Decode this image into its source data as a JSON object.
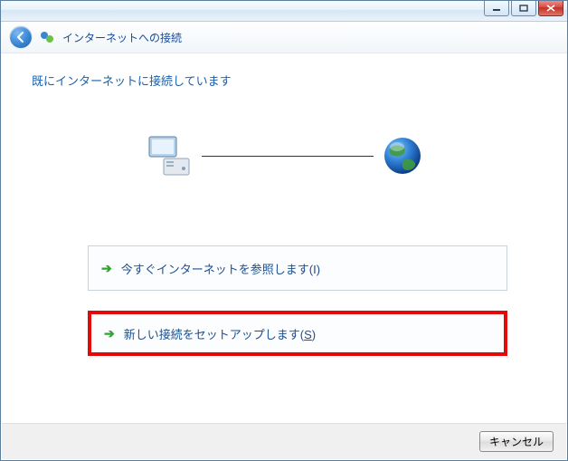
{
  "header": {
    "title": "インターネットへの接続"
  },
  "body": {
    "message": "既にインターネットに接続しています"
  },
  "options": {
    "browse": {
      "label": "今すぐインターネットを参照します",
      "accel": "(I)"
    },
    "setup": {
      "label": "新しい接続をセットアップします",
      "accel_pre": "(",
      "accel_key": "S",
      "accel_post": ")"
    }
  },
  "footer": {
    "cancel": "キャンセル"
  }
}
